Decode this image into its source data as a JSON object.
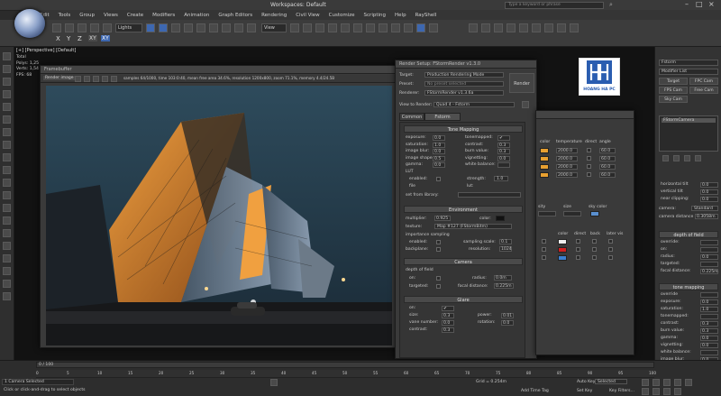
{
  "app": {
    "title": "Workspaces: Default",
    "search_placeholder": "Type a keyword or phrase"
  },
  "menu": [
    "Edit",
    "Tools",
    "Group",
    "Views",
    "Create",
    "Modifiers",
    "Animation",
    "Graph Editors",
    "Rendering",
    "Civil View",
    "Customize",
    "Scripting",
    "Help",
    "RayShell"
  ],
  "toolbar": {
    "filter": "Lights",
    "view": "View",
    "axes": [
      "X",
      "Y",
      "Z"
    ],
    "axes_combo": [
      "XY",
      "XY"
    ]
  },
  "viewport": {
    "label": "[+] [Perspective] [Default]",
    "stats": [
      "Total",
      "Polys: 1,25",
      "Verts: 1,54",
      "",
      "FPS: 68"
    ]
  },
  "framebuffer": {
    "title": "Framebuffer",
    "toolbar_label": "Render image",
    "status": "samples 64/1000, time 103:0:40, mean free area 34.6%, resolution 1200x800, zoom 71.1%, memory 4.4/24.5B",
    "image_desc": "rendered building"
  },
  "render_setup": {
    "title": "Render Setup: FStormRender v1.3.0",
    "target_label": "Target:",
    "target_value": "Production Rendering Mode",
    "preset_label": "Preset:",
    "preset_value": "No preset selected",
    "renderer_label": "Renderer:",
    "renderer_value": "FStormRender v1.3.6a",
    "view_label": "View to Render:",
    "view_value": "Quad 4 - Fstorm",
    "render_button": "Render",
    "tabs": [
      "Common",
      "Fstorm settings"
    ],
    "tone_mapping": {
      "header": "Tone Mapping",
      "left": [
        {
          "label": "exposure:",
          "value": "0.0"
        },
        {
          "label": "saturation:",
          "value": "1.0"
        },
        {
          "label": "image blur:",
          "value": "0.0"
        },
        {
          "label": "image shape:",
          "value": "0.5"
        },
        {
          "label": "gamma:",
          "value": "0.0"
        }
      ],
      "right": [
        {
          "label": "tonemapped:",
          "value": "✔"
        },
        {
          "label": "contrast:",
          "value": "0.3"
        },
        {
          "label": "burn value:",
          "value": "0.3"
        },
        {
          "label": "vignetting:",
          "value": "0.0"
        },
        {
          "label": "white balance:",
          "value": ""
        }
      ],
      "lut": "LUT",
      "enabled_label": "enabled:",
      "strength_label": "strength:",
      "strength_value": "1.0",
      "file_label": "file",
      "lut_label": "lut:",
      "list_label": "set from library:"
    },
    "environment": {
      "header": "Environment",
      "multiplier_label": "multiplier:",
      "multiplier_value": "0.925",
      "color_label": "color:",
      "texture_label": "texture:",
      "texture_value": "Map #127 (FStormBitm)",
      "importance_label": "importance sampling",
      "enabled_label": "enabled:",
      "sampling_label": "sampling scale:",
      "sampling_value": "0.1",
      "background_label": "backplane:",
      "resolution_label": "resolution:",
      "resolution_value": "1024"
    },
    "camera": {
      "header": "Camera",
      "dof_label": "depth of field",
      "on_label": "on:",
      "radius_label": "radius:",
      "radius_value": "0.0m",
      "targeted_label": "targeted:",
      "focal_label": "focal distance:",
      "focal_value": "0.225m"
    },
    "glare": {
      "header": "Glare",
      "rows": [
        {
          "label": "on:",
          "value": "✔",
          "label2": "",
          "value2": ""
        },
        {
          "label": "size:",
          "value": "0.3",
          "label2": "power:",
          "value2": "0.01"
        },
        {
          "label": "vane number:",
          "value": "0.0",
          "label2": "rotation:",
          "value2": "0.0"
        },
        {
          "label": "contrast:",
          "value": "0.3",
          "label2": "",
          "value2": ""
        }
      ]
    }
  },
  "light_lister": {
    "headers": [
      "color",
      "temperature",
      "direct",
      "angle"
    ],
    "rows": [
      {
        "color": "#e8a030",
        "temp": "2000.0",
        "angle": "60.0"
      },
      {
        "color": "#e8a030",
        "temp": "2000.0",
        "angle": "60.0"
      },
      {
        "color": "#e8a030",
        "temp": "2000.0",
        "angle": "60.0"
      },
      {
        "color": "#e8a030",
        "temp": "2000.0",
        "angle": "60.0"
      }
    ],
    "intensity_label": "sity",
    "size_label": "size",
    "sky_label": "sky color",
    "sub_headers": [
      "color",
      "direct",
      "back",
      "later vis"
    ],
    "sub_rows": [
      {
        "color": "#f0f0f0"
      },
      {
        "color": "#d02020"
      },
      {
        "color": "#3a7fd0"
      }
    ]
  },
  "right_panel": {
    "object": "Fstorm",
    "modifier_list": "Modifier List",
    "camera_name": "FStormCamera",
    "params": [
      {
        "label": "horizontal tilt",
        "value": "0.0"
      },
      {
        "label": "vertical tilt",
        "value": "0.0"
      },
      {
        "label": "near clipping:",
        "value": "0.0"
      }
    ],
    "type_label": "camera:",
    "type_value": "Standard",
    "dist_label": "camera distance",
    "dist_value": "0.3058m",
    "dof_header": "depth of field",
    "dof_rows": [
      {
        "label": "override:",
        "value": ""
      },
      {
        "label": "on:",
        "value": ""
      },
      {
        "label": "radius:",
        "value": "0.0"
      },
      {
        "label": "targeted:",
        "value": ""
      },
      {
        "label": "focal distance:",
        "value": "0.225m"
      }
    ],
    "tone_header": "tone mapping",
    "tone_rows": [
      {
        "label": "override",
        "value": ""
      },
      {
        "label": "exposure:",
        "value": "0.0"
      },
      {
        "label": "saturation:",
        "value": "1.0"
      },
      {
        "label": "tonemapped:",
        "value": ""
      },
      {
        "label": "contrast:",
        "value": "0.3"
      },
      {
        "label": "burn value:",
        "value": "0.3"
      },
      {
        "label": "gamma:",
        "value": "0.0"
      },
      {
        "label": "vignetting:",
        "value": "0.0"
      },
      {
        "label": "white balance:",
        "value": ""
      },
      {
        "label": "image blur:",
        "value": "0.0"
      },
      {
        "label": "image shape:",
        "value": "0.5"
      }
    ],
    "buttons": [
      "Target",
      "FPC Cam",
      "FPS Cam",
      "Free Cam",
      "Sky Cam"
    ]
  },
  "logo": {
    "text": "HOANG HA PC"
  },
  "timeline": {
    "frame": "0 / 100",
    "ticks": [
      "0",
      "5",
      "10",
      "15",
      "20",
      "25",
      "30",
      "35",
      "40",
      "45",
      "50",
      "55",
      "60",
      "65",
      "70",
      "75",
      "80",
      "85",
      "90",
      "95",
      "100"
    ]
  },
  "status": {
    "selected": "1 Camera Selected",
    "prompt": "Click or click-and-drag to select objects",
    "grid": "Grid = 0.254m",
    "add_time_tag": "Add Time Tag",
    "auto_key": "Auto Key",
    "set_key": "Set Key",
    "selected_label": "Selected",
    "key_filters": "Key Filters..."
  },
  "colors": {
    "accent": "#3d67b0",
    "panel": "#3a3a3a",
    "logo_blue": "#2a5db0"
  }
}
